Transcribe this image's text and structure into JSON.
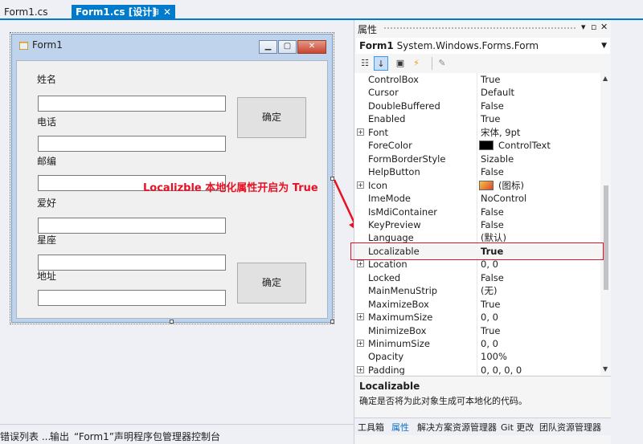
{
  "doc_tabs": {
    "inactive_label": "Form1.cs",
    "active_label": "Form1.cs [设计]",
    "pin_glyph": "⊞",
    "close_glyph": "✕"
  },
  "form": {
    "title": "Form1",
    "fields": [
      {
        "label": "姓名"
      },
      {
        "label": "电话"
      },
      {
        "label": "邮编"
      },
      {
        "label": "爱好"
      },
      {
        "label": "星座"
      },
      {
        "label": "地址"
      }
    ],
    "button1_label": "确定",
    "button2_label": "确定"
  },
  "annotation": "Localizble 本地化属性开启为  True",
  "bottom_tabs": [
    "错误列表 ...",
    "输出",
    "“Form1”声明",
    "程序包管理器控制台"
  ],
  "properties": {
    "header_title": "属性",
    "object_name": "Form1",
    "object_type": "System.Windows.Forms.Form",
    "rows": [
      {
        "name": "ControlBox",
        "value": "True",
        "expander": ""
      },
      {
        "name": "Cursor",
        "value": "Default",
        "expander": ""
      },
      {
        "name": "DoubleBuffered",
        "value": "False",
        "expander": ""
      },
      {
        "name": "Enabled",
        "value": "True",
        "expander": ""
      },
      {
        "name": "Font",
        "value": "宋体, 9pt",
        "expander": "+"
      },
      {
        "name": "ForeColor",
        "value": "ControlText",
        "expander": ""
      },
      {
        "name": "FormBorderStyle",
        "value": "Sizable",
        "expander": ""
      },
      {
        "name": "HelpButton",
        "value": "False",
        "expander": ""
      },
      {
        "name": "Icon",
        "value": "(图标)",
        "expander": "+"
      },
      {
        "name": "ImeMode",
        "value": "NoControl",
        "expander": ""
      },
      {
        "name": "IsMdiContainer",
        "value": "False",
        "expander": ""
      },
      {
        "name": "KeyPreview",
        "value": "False",
        "expander": ""
      },
      {
        "name": "Language",
        "value": "(默认)",
        "expander": ""
      },
      {
        "name": "Localizable",
        "value": "True",
        "expander": ""
      },
      {
        "name": "Location",
        "value": "0, 0",
        "expander": "+"
      },
      {
        "name": "Locked",
        "value": "False",
        "expander": ""
      },
      {
        "name": "MainMenuStrip",
        "value": "(无)",
        "expander": ""
      },
      {
        "name": "MaximizeBox",
        "value": "True",
        "expander": ""
      },
      {
        "name": "MaximumSize",
        "value": "0, 0",
        "expander": "+"
      },
      {
        "name": "MinimizeBox",
        "value": "True",
        "expander": ""
      },
      {
        "name": "MinimumSize",
        "value": "0, 0",
        "expander": "+"
      },
      {
        "name": "Opacity",
        "value": "100%",
        "expander": ""
      },
      {
        "name": "Padding",
        "value": "0, 0, 0, 0",
        "expander": "+"
      }
    ],
    "description_title": "Localizable",
    "description_text": "确定是否将为此对象生成可本地化的代码。",
    "tabs": [
      "工具箱",
      "属性",
      "解决方案资源管理器",
      "Git 更改",
      "团队资源管理器"
    ],
    "colors": {
      "forecolor_swatch": "#000000",
      "highlight": "#e81123",
      "accent": "#007acc"
    }
  }
}
